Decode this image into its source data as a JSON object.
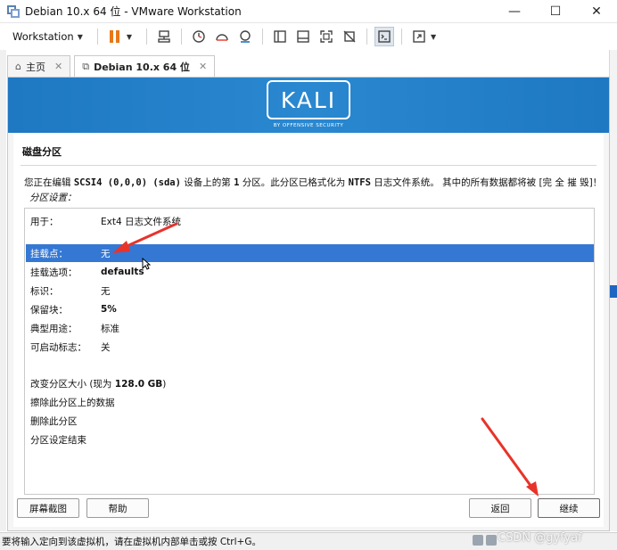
{
  "window": {
    "title": "Debian 10.x 64 位 - VMware Workstation",
    "minimize": "—",
    "maximize": "☐",
    "close": "✕"
  },
  "toolbar": {
    "menu_label": "Workstation",
    "menu_caret": "▼",
    "dropdown_caret": "▼"
  },
  "tabs": [
    {
      "label": "主页",
      "icon": "home-icon",
      "close": "✕"
    },
    {
      "label": "Debian 10.x 64 位",
      "icon": "vm-icon",
      "close": "✕"
    }
  ],
  "vm": {
    "brand": "KALI",
    "brand_sub": "BY OFFENSIVE SECURITY",
    "page_title": "磁盘分区",
    "desc_prefix": "您正在编辑 ",
    "desc_device": "SCSI4 (0,0,0) (sda)",
    "desc_mid1": " 设备上的第 ",
    "desc_num": "1",
    "desc_mid2": " 分区。此分区已格式化为 ",
    "desc_fs": "NTFS",
    "desc_suffix": " 日志文件系统。 其中的所有数据都将被 [完 全 摧 毁]！",
    "settings_label": "分区设置：",
    "rows": [
      {
        "key": "用于：",
        "value": "Ext4 日志文件系统",
        "bold": false
      },
      {
        "key": "挂载点：",
        "value": "无",
        "bold": false
      },
      {
        "key": "挂载选项：",
        "value": "defaults",
        "bold": true
      },
      {
        "key": "标识：",
        "value": "无",
        "bold": false
      },
      {
        "key": "保留块：",
        "value": "5%",
        "bold": true
      },
      {
        "key": "典型用途：",
        "value": "标准",
        "bold": false
      },
      {
        "key": "可启动标志：",
        "value": "关",
        "bold": false
      }
    ],
    "resize_prefix": "改变分区大小 (现为 ",
    "resize_size": "128.0 GB",
    "resize_suffix": ")",
    "actions": [
      "擦除此分区上的数据",
      "删除此分区",
      "分区设定结束"
    ],
    "buttons": {
      "screenshot": "屏幕截图",
      "help": "帮助",
      "back": "返回",
      "continue": "继续"
    }
  },
  "statusbar": {
    "text": "要将输入定向到该虚拟机，请在虚拟机内部单击或按 Ctrl+G。"
  },
  "watermark": "CSDN @gyfyaf",
  "colors": {
    "banner": "#2a88d0",
    "selection": "#3478d4",
    "arrow": "#e8332a",
    "pause": "#e8771a"
  }
}
